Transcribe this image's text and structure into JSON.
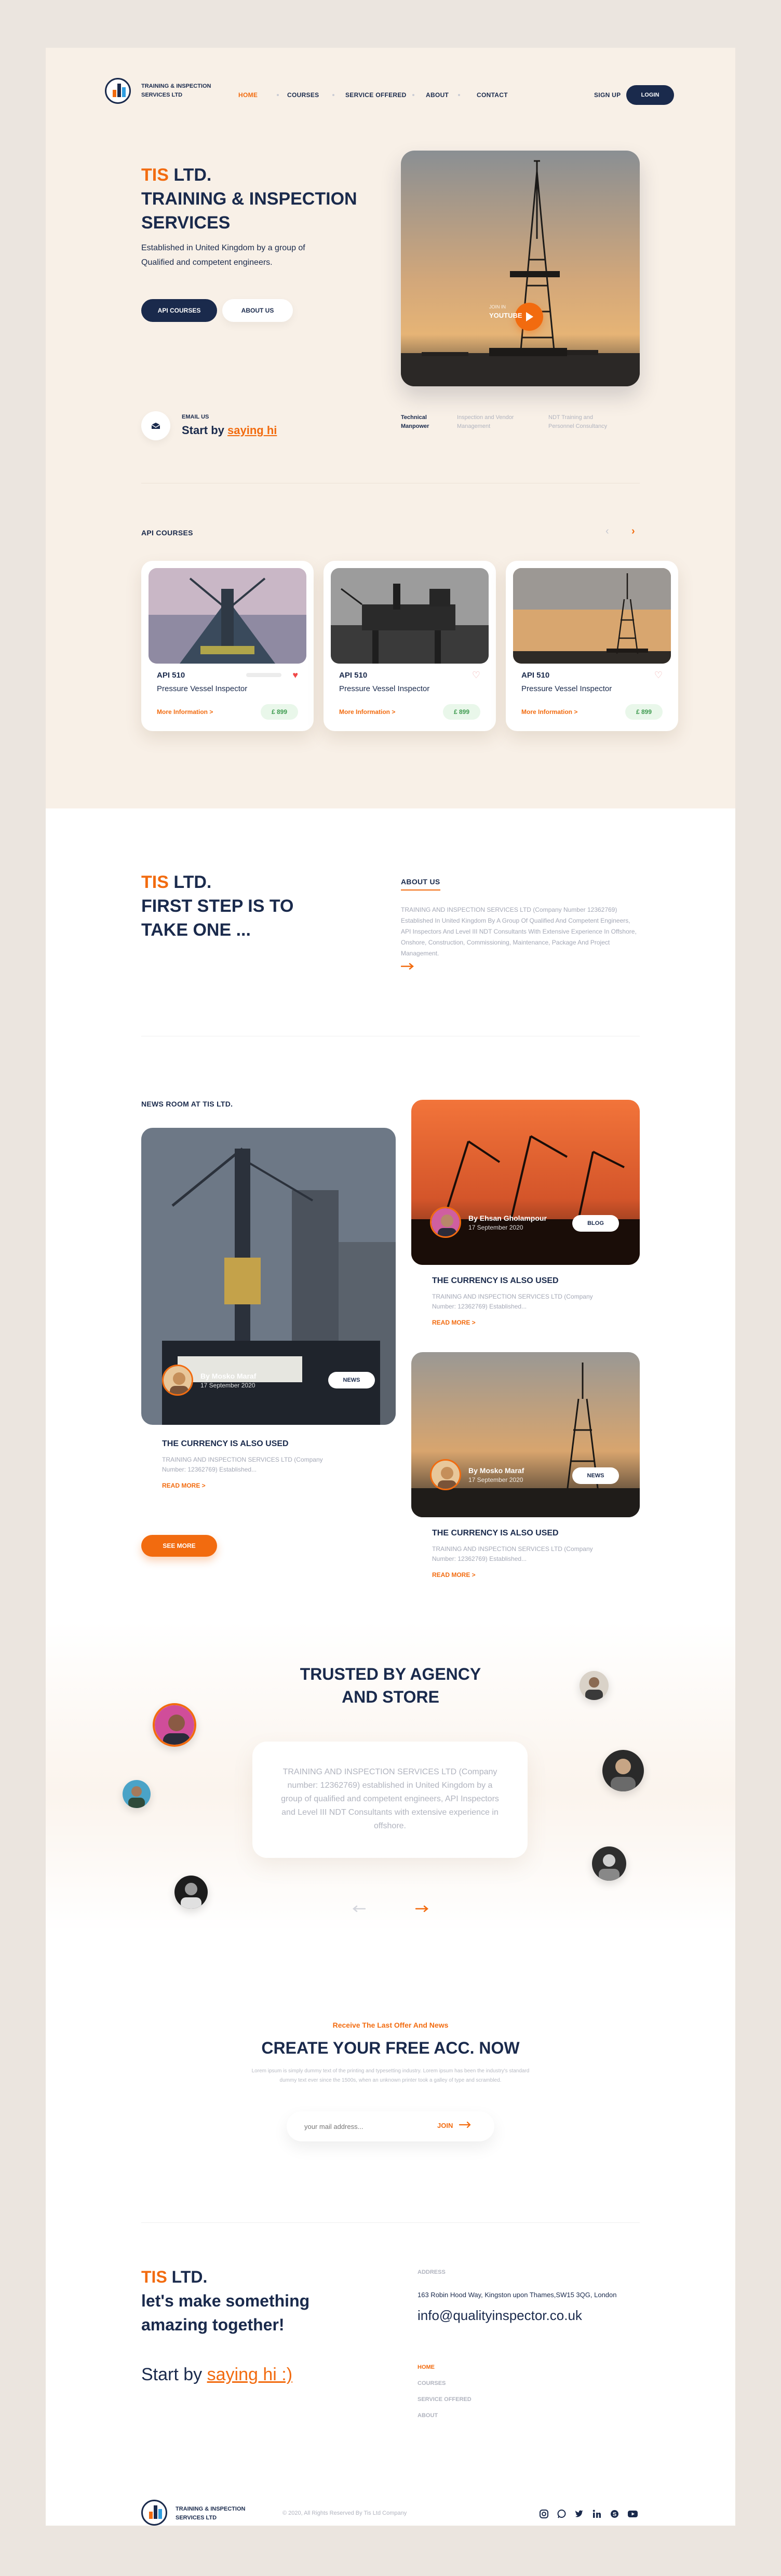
{
  "brand": {
    "name_line1": "TRAINING & INSPECTION",
    "name_line2": "SERVICES LTD"
  },
  "nav": {
    "items": [
      "HOME",
      "COURSES",
      "SERVICE OFFERED",
      "ABOUT",
      "CONTACT"
    ],
    "sign_up": "SIGN UP",
    "login": "LOGIN"
  },
  "hero": {
    "title_accent": "TIS",
    "title_rest": " LTD.",
    "title_line2": "TRAINING & INSPECTION",
    "title_line3": "SERVICES",
    "subtitle_line1": "Established in United Kingdom by a group of",
    "subtitle_line2": "Qualified and competent engineers.",
    "btn_primary": "API COURSES",
    "btn_secondary": "ABOUT US",
    "email_label": "EMAIL US",
    "email_cta_prefix": "Start by ",
    "email_cta_link": "saying hi",
    "video_label_line1": "JOIN IN",
    "video_label_line2": "YOUTUBE",
    "tabs": [
      {
        "line1": "Technical",
        "line2": "Manpower"
      },
      {
        "line1": "Inspection and Vendor",
        "line2": "Management"
      },
      {
        "line1": "NDT Training and",
        "line2": "Personnel Consultancy"
      }
    ]
  },
  "api_courses": {
    "heading": "API COURSES",
    "prev_icon": "chevron-left-icon",
    "next_icon": "chevron-right-icon",
    "cards": [
      {
        "code": "API 510",
        "title": "Pressure Vessel Inspector",
        "more": "More Information >",
        "price": "£ 899",
        "liked": true
      },
      {
        "code": "API 510",
        "title": "Pressure Vessel Inspector",
        "more": "More Information >",
        "price": "£ 899",
        "liked": false
      },
      {
        "code": "API 510",
        "title": "Pressure Vessel Inspector",
        "more": "More Information >",
        "price": "£ 899",
        "liked": false
      }
    ]
  },
  "about": {
    "title_accent": "TIS",
    "title_rest": " LTD.",
    "title_line2": "FIRST STEP IS TO",
    "title_line3": "TAKE ONE ...",
    "label": "ABOUT US",
    "body": "TRAINING AND INSPECTION SERVICES LTD (Company Number 12362769) Established In United Kingdom By A Group Of Qualified And Competent Engineers, API Inspectors And Level III NDT Consultants With Extensive Experience In Offshore, Onshore, Construction, Commissioning, Maintenance, Package And Project Management."
  },
  "news": {
    "heading": "NEWS ROOM AT TIS LTD.",
    "see_more": "SEE MORE",
    "items": [
      {
        "author": "By Mosko Maraf",
        "date": "17 September 2020",
        "badge": "NEWS",
        "title": "THE CURRENCY IS ALSO USED",
        "body_line1": "TRAINING AND INSPECTION SERVICES LTD (Company",
        "body_line2": "Number: 12362769) Established...",
        "read_more": "READ MORE >"
      },
      {
        "author": "By Ehsan Gholampour",
        "date": "17 September 2020",
        "badge": "BLOG",
        "title": "THE CURRENCY IS ALSO USED",
        "body_line1": "TRAINING AND INSPECTION SERVICES LTD (Company",
        "body_line2": "Number: 12362769) Established...",
        "read_more": "READ MORE >"
      },
      {
        "author": "By Mosko Maraf",
        "date": "17 September 2020",
        "badge": "NEWS",
        "title": "THE CURRENCY IS ALSO USED",
        "body_line1": "TRAINING AND INSPECTION SERVICES LTD (Company",
        "body_line2": "Number: 12362769) Established...",
        "read_more": "READ MORE >"
      }
    ]
  },
  "trusted": {
    "title_line1": "TRUSTED BY AGENCY",
    "title_line2": "AND STORE",
    "quote": "TRAINING AND INSPECTION SERVICES LTD (Company number: 12362769) established in United Kingdom by a group of qualified and competent engineers, API Inspectors and Level III NDT Consultants with extensive experience in offshore."
  },
  "newsletter": {
    "kicker": "Receive The Last Offer And News",
    "title": "CREATE YOUR FREE ACC. NOW",
    "body_line1": "Lorem ipsum is simply dummy text of the printing and typesetting industry. Lorem ipsum has been the industry's standard",
    "body_line2": "dummy text ever since the 1500s, when an unknown printer took a galley of type and scrambled.",
    "placeholder": "your mail address...",
    "join": "JOIN"
  },
  "footer": {
    "title_accent": "TIS",
    "title_rest": " LTD.",
    "title_line2": "let's make something",
    "title_line3": "amazing together!",
    "cta_prefix": "Start by ",
    "cta_link": "saying hi :)",
    "address_label": "ADDRESS",
    "address": "163 Robin Hood Way, Kingston upon Thames,SW15 3QG, London",
    "email": "info@qualityinspector.co.uk",
    "links": [
      "HOME",
      "COURSES",
      "SERVICE OFFERED",
      "ABOUT"
    ],
    "copyright": "© 2020, All Rights Reserved By Tis Ltd Company",
    "social_icons": [
      "instagram-icon",
      "whatsapp-icon",
      "twitter-icon",
      "linkedin-icon",
      "skype-icon",
      "youtube-icon"
    ]
  },
  "colors": {
    "accent": "#f26b0f",
    "navy": "#1a2a4c",
    "hero_bg": "#f8f0e7",
    "page_bg": "#ebe5df"
  }
}
